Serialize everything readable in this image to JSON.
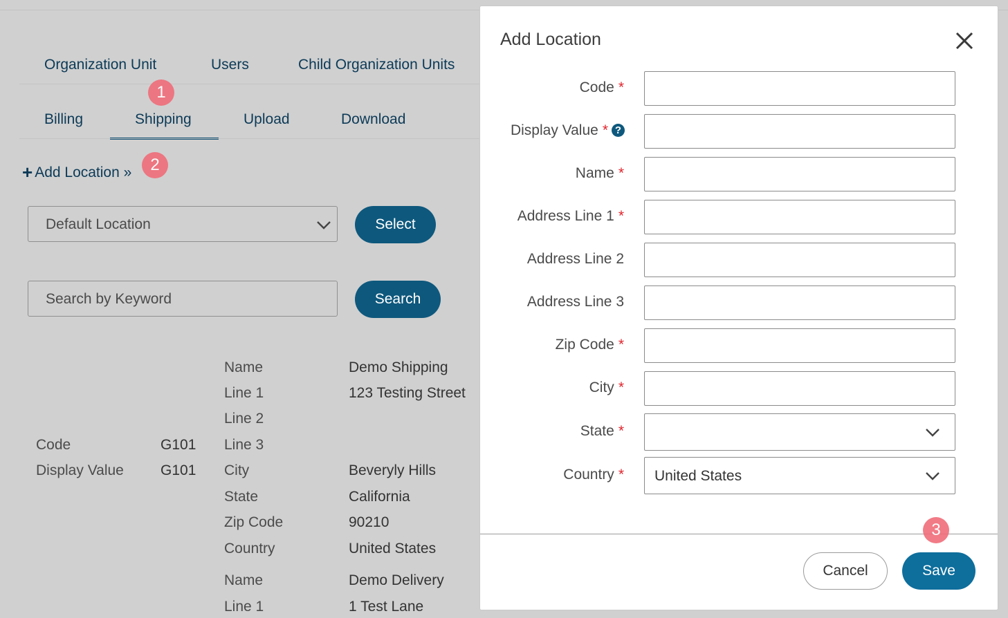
{
  "tabs_row1": [
    "Organization Unit",
    "Users",
    "Child Organization Units"
  ],
  "tabs_row2": [
    "Billing",
    "Shipping",
    "Upload",
    "Download"
  ],
  "active_tab": "Shipping",
  "badges": [
    "1",
    "2",
    "3"
  ],
  "add_location": {
    "icon": "plus-icon",
    "label": "Add Location »"
  },
  "location_select": {
    "value": "Default Location",
    "icon": "chevron-down-icon"
  },
  "select_button": "Select",
  "search": {
    "placeholder": "Search by Keyword",
    "button": "Search"
  },
  "record": {
    "code_label": "Code",
    "code_value": "G101",
    "display_label": "Display Value",
    "display_value": "G101",
    "shipping": [
      {
        "label": "Name",
        "value": "Demo Shipping"
      },
      {
        "label": "Line 1",
        "value": "123 Testing Street"
      },
      {
        "label": "Line 2",
        "value": ""
      },
      {
        "label": "Line 3",
        "value": ""
      },
      {
        "label": "City",
        "value": "Beveryly Hills"
      },
      {
        "label": "State",
        "value": "California"
      },
      {
        "label": "Zip Code",
        "value": "90210"
      },
      {
        "label": "Country",
        "value": "United States"
      }
    ],
    "delivery": [
      {
        "label": "Name",
        "value": "Demo Delivery"
      },
      {
        "label": "Line 1",
        "value": "1 Test Lane"
      }
    ]
  },
  "modal": {
    "title": "Add Location",
    "close_icon": "close-icon",
    "required_mark": "*",
    "help_mark": "?",
    "fields": {
      "code": "Code",
      "display_value": "Display Value",
      "name": "Name",
      "address1": "Address Line 1",
      "address2": "Address Line 2",
      "address3": "Address Line 3",
      "zip": "Zip Code",
      "city": "City",
      "state": "State",
      "country": "Country"
    },
    "state_value": "",
    "country_value": "United States",
    "cancel": "Cancel",
    "save": "Save"
  },
  "colors": {
    "primary": "#0e587d",
    "save": "#0e6e9c",
    "required": "#e0252e",
    "badge": "#f06d79"
  }
}
